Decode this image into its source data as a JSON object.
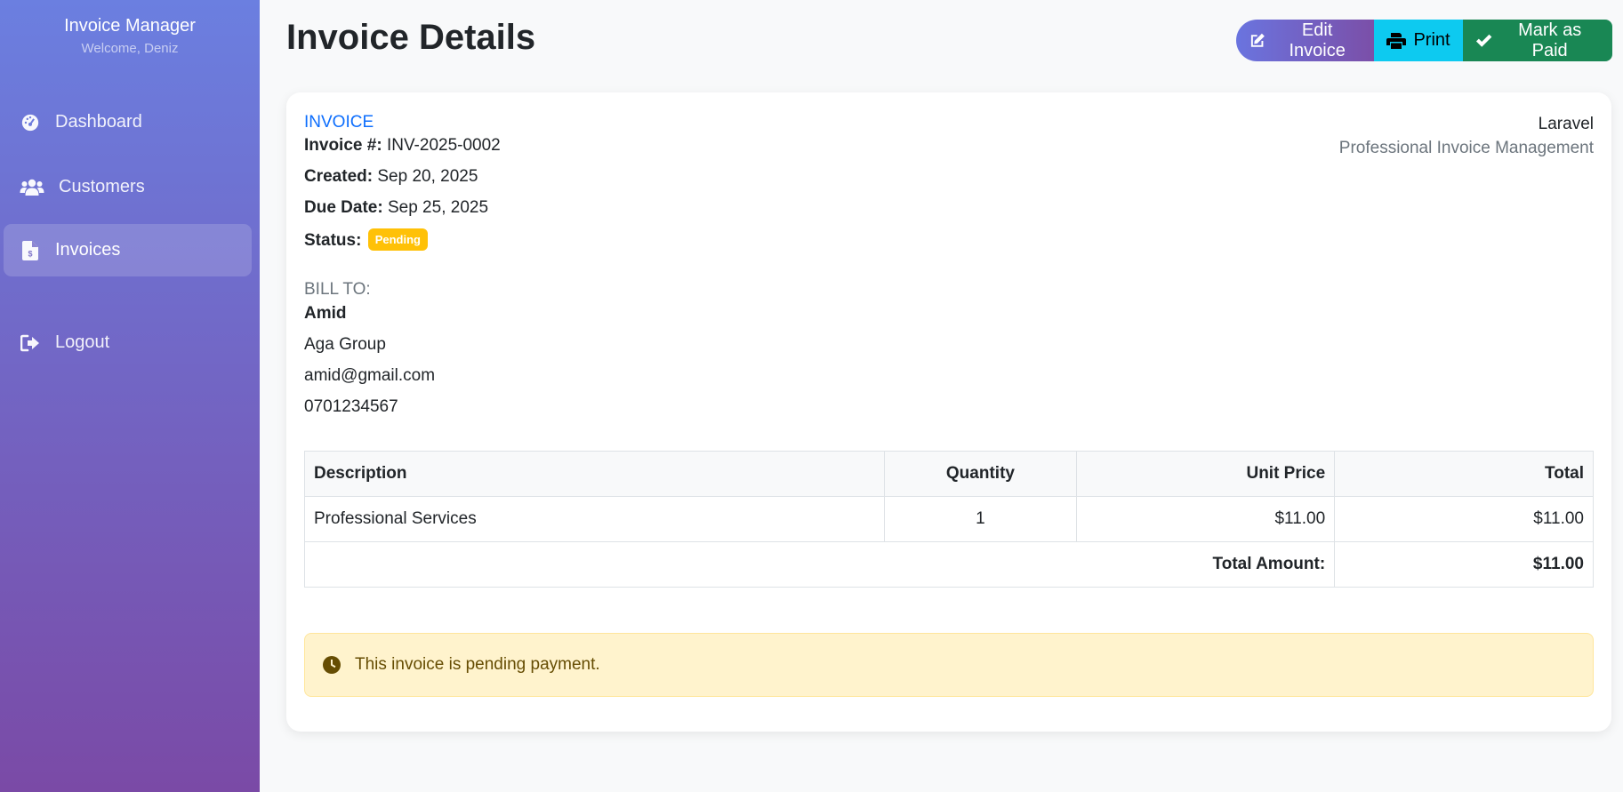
{
  "sidebar": {
    "title": "Invoice Manager",
    "welcome": "Welcome, Deniz",
    "items": [
      {
        "label": "Dashboard",
        "icon": "gauge-icon"
      },
      {
        "label": "Customers",
        "icon": "users-icon"
      },
      {
        "label": "Invoices",
        "icon": "file-invoice-icon",
        "active": true
      },
      {
        "label": "Logout",
        "icon": "logout-icon"
      }
    ]
  },
  "header": {
    "title": "Invoice Details",
    "buttons": {
      "edit": "Edit Invoice",
      "print": "Print",
      "mark_paid": "Mark as Paid"
    }
  },
  "invoice": {
    "label": "INVOICE",
    "number_label": "Invoice #:",
    "number": "INV-2025-0002",
    "created_label": "Created:",
    "created": "Sep 20, 2025",
    "due_label": "Due Date:",
    "due": "Sep 25, 2025",
    "status_label": "Status:",
    "status": "Pending",
    "status_color": "#ffc107"
  },
  "company": {
    "name": "Laravel",
    "tagline": "Professional Invoice Management"
  },
  "bill_to": {
    "label": "BILL TO:",
    "name": "Amid",
    "company": "Aga Group",
    "email": "amid@gmail.com",
    "phone": "0701234567"
  },
  "table": {
    "headers": {
      "description": "Description",
      "quantity": "Quantity",
      "unit_price": "Unit Price",
      "total": "Total"
    },
    "rows": [
      {
        "description": "Professional Services",
        "quantity": "1",
        "unit_price": "$11.00",
        "total": "$11.00"
      }
    ],
    "total_label": "Total Amount:",
    "total_value": "$11.00"
  },
  "alert": {
    "message": "This invoice is pending payment."
  },
  "colors": {
    "accent": "#0d6efd",
    "print": "#0dcaf0",
    "success": "#198754",
    "warning_bg": "#fff3cd"
  }
}
